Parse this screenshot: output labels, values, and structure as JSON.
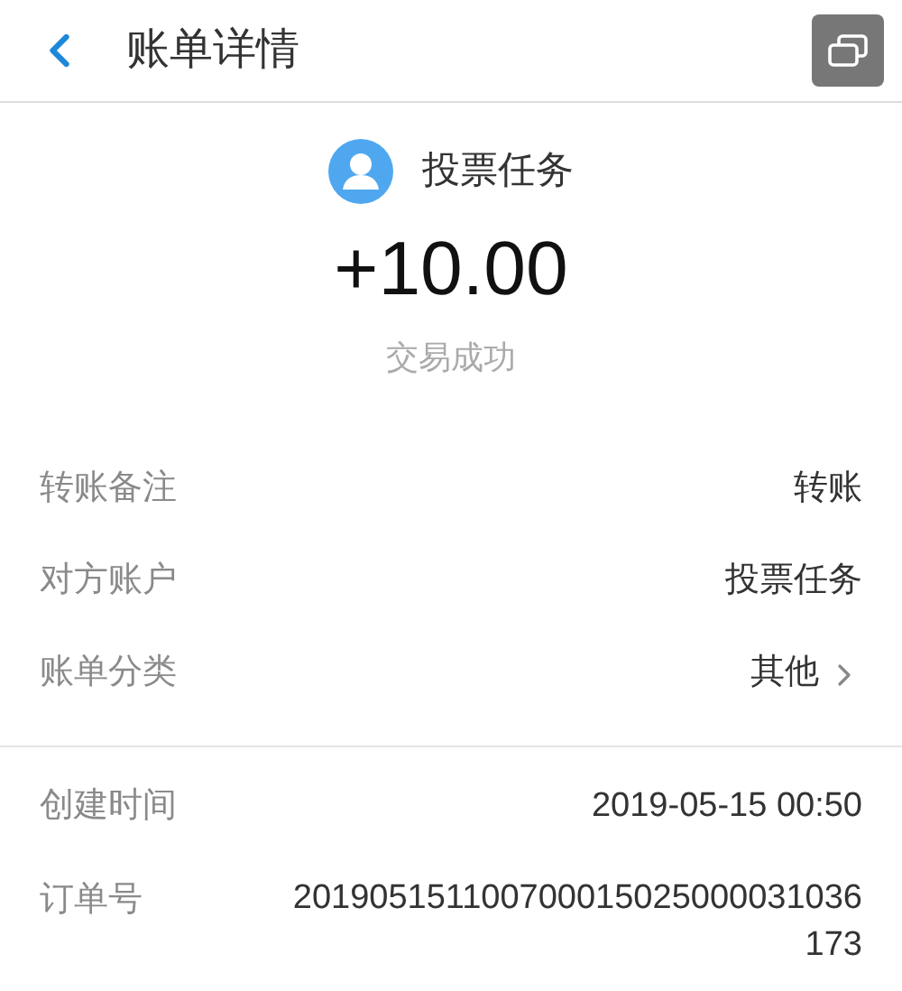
{
  "header": {
    "title": "账单详情"
  },
  "summary": {
    "payee": "投票任务",
    "amount": "+10.00",
    "status": "交易成功"
  },
  "sections": [
    {
      "rows": [
        {
          "label": "转账备注",
          "value": "转账",
          "kind": "plain"
        },
        {
          "label": "对方账户",
          "value": "投票任务",
          "kind": "plain"
        },
        {
          "label": "账单分类",
          "value": "其他",
          "kind": "link"
        }
      ]
    },
    {
      "rows": [
        {
          "label": "创建时间",
          "value": "2019-05-15 00:50",
          "kind": "plain"
        },
        {
          "label": "订单号",
          "value": "201905151100700015025000031036173",
          "kind": "number"
        }
      ]
    }
  ]
}
